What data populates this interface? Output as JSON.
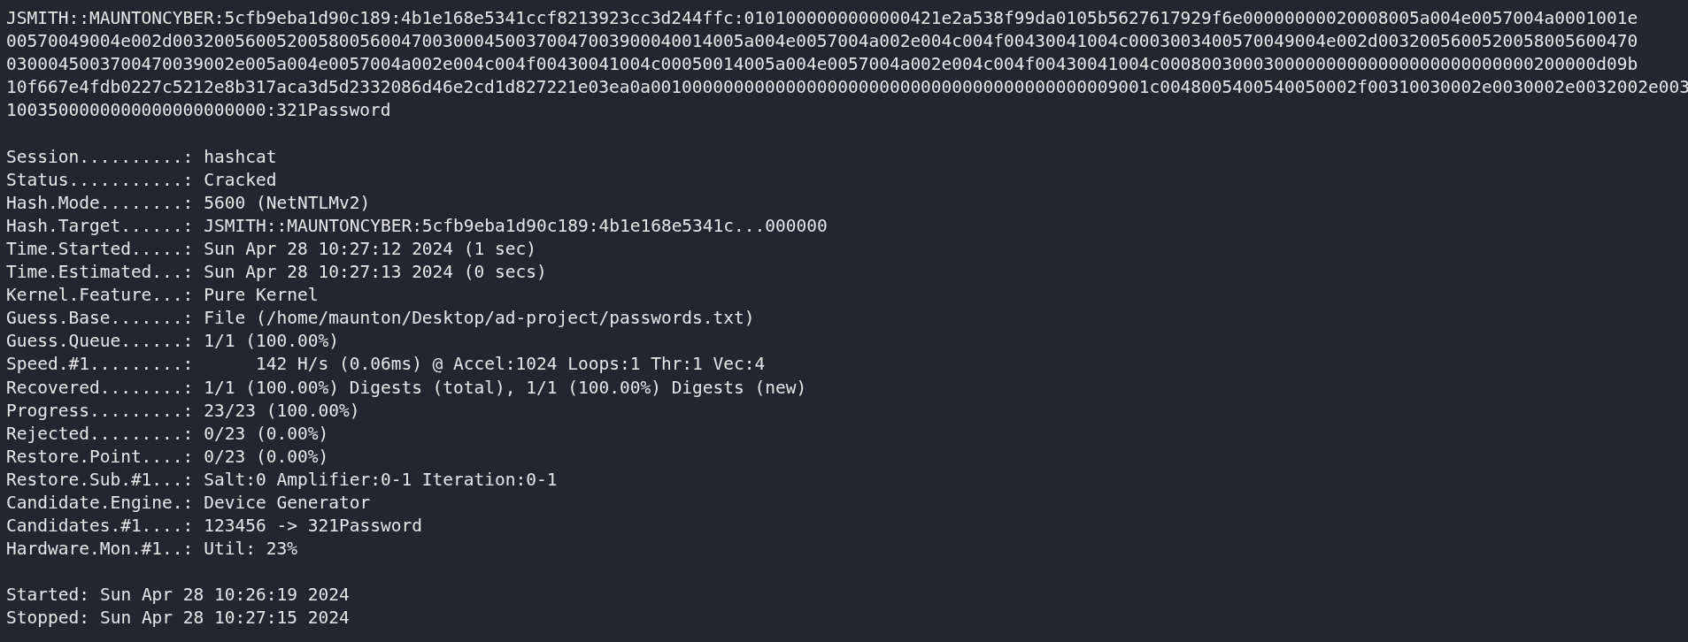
{
  "hash_output": [
    "JSMITH::MAUNTONCYBER:5cfb9eba1d90c189:4b1e168e5341ccf8213923cc3d244ffc:0101000000000000421e2a538f99da0105b5627617929f6e00000000020008005a004e0057004a0001001e",
    "00570049004e002d0032005600520058005600470030004500370047003900040014005a004e0057004a002e004c004f00430041004c0003003400570049004e002d0032005600520058005600470",
    "0300045003700470039002e005a004e0057004a002e004c004f00430041004c00050014005a004e0057004a002e004c004f00430041004c000800300030000000000000000000000000200000d09b",
    "10f667e4fdb0227c5212e8b317aca3d5d2332086d46e2cd1d827221e03ea0a001000000000000000000000000000000000000000009001c0048005400540050002f00310030002e0030002e0032002e003",
    "1003500000000000000000000:321Password"
  ],
  "status": [
    {
      "label": "Session..........:",
      "value": "hashcat"
    },
    {
      "label": "Status...........:",
      "value": "Cracked"
    },
    {
      "label": "Hash.Mode........:",
      "value": "5600 (NetNTLMv2)"
    },
    {
      "label": "Hash.Target......:",
      "value": "JSMITH::MAUNTONCYBER:5cfb9eba1d90c189:4b1e168e5341c...000000"
    },
    {
      "label": "Time.Started.....:",
      "value": "Sun Apr 28 10:27:12 2024 (1 sec)"
    },
    {
      "label": "Time.Estimated...:",
      "value": "Sun Apr 28 10:27:13 2024 (0 secs)"
    },
    {
      "label": "Kernel.Feature...:",
      "value": "Pure Kernel"
    },
    {
      "label": "Guess.Base.......:",
      "value": "File (/home/maunton/Desktop/ad-project/passwords.txt)"
    },
    {
      "label": "Guess.Queue......:",
      "value": "1/1 (100.00%)"
    },
    {
      "label": "Speed.#1.........:",
      "value": "     142 H/s (0.06ms) @ Accel:1024 Loops:1 Thr:1 Vec:4"
    },
    {
      "label": "Recovered........:",
      "value": "1/1 (100.00%) Digests (total), 1/1 (100.00%) Digests (new)"
    },
    {
      "label": "Progress.........:",
      "value": "23/23 (100.00%)"
    },
    {
      "label": "Rejected.........:",
      "value": "0/23 (0.00%)"
    },
    {
      "label": "Restore.Point....:",
      "value": "0/23 (0.00%)"
    },
    {
      "label": "Restore.Sub.#1...:",
      "value": "Salt:0 Amplifier:0-1 Iteration:0-1"
    },
    {
      "label": "Candidate.Engine.:",
      "value": "Device Generator"
    },
    {
      "label": "Candidates.#1....:",
      "value": "123456 -> 321Password"
    },
    {
      "label": "Hardware.Mon.#1..:",
      "value": "Util: 23%"
    }
  ],
  "timing": [
    {
      "label": "Started:",
      "value": "Sun Apr 28 10:26:19 2024"
    },
    {
      "label": "Stopped:",
      "value": "Sun Apr 28 10:27:15 2024"
    }
  ]
}
